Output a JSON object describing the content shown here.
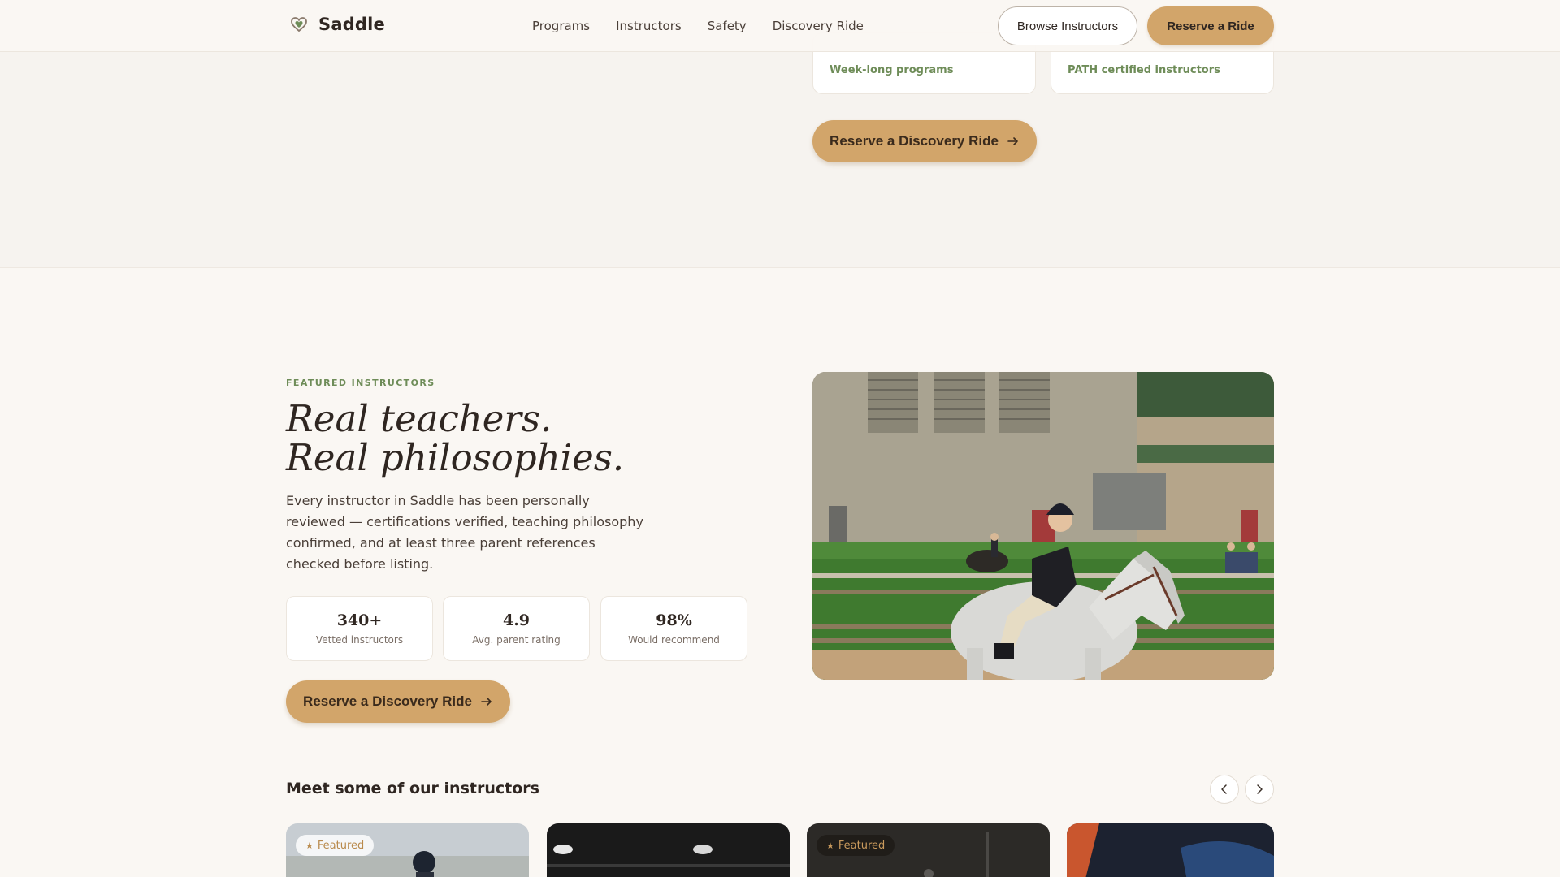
{
  "brand": {
    "name": "Saddle",
    "logo_icon": "heart-horseshoe-icon"
  },
  "nav": {
    "items": [
      "Programs",
      "Instructors",
      "Safety",
      "Discovery Ride"
    ]
  },
  "header_actions": {
    "browse_label": "Browse Instructors",
    "reserve_label": "Reserve a Ride"
  },
  "programs_remnant": {
    "cards": [
      {
        "label": "Week-long programs"
      },
      {
        "label": "PATH certified instructors"
      }
    ],
    "cta_label": "Reserve a Discovery Ride"
  },
  "featured": {
    "eyebrow": "FEATURED INSTRUCTORS",
    "headline_line1": "Real teachers.",
    "headline_line2": "Real philosophies.",
    "description": "Every instructor in Saddle has been personally reviewed — certifications verified, teaching philosophy confirmed, and at least three parent references checked before listing.",
    "stats": [
      {
        "value": "340+",
        "label": "Vetted instructors"
      },
      {
        "value": "4.9",
        "label": "Avg. parent rating"
      },
      {
        "value": "98%",
        "label": "Would recommend"
      }
    ],
    "cta_label": "Reserve a Discovery Ride"
  },
  "instructors": {
    "heading": "Meet some of our instructors",
    "badge_label": "Featured",
    "cards": [
      {
        "featured": true
      },
      {
        "featured": false
      },
      {
        "featured": true
      },
      {
        "featured": false
      }
    ]
  },
  "colors": {
    "accent": "#d2a56a",
    "green": "#6e8c58",
    "background": "#faf7f3",
    "text": "#2f2621"
  }
}
